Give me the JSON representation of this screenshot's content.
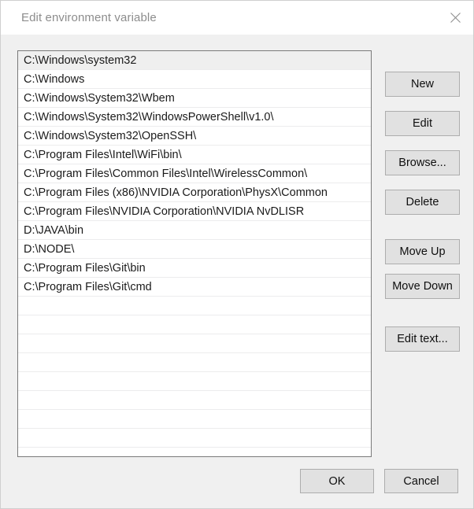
{
  "window": {
    "title": "Edit environment variable",
    "close_icon": "close-icon"
  },
  "list": {
    "selected_index": 0,
    "empty_row_count": 9,
    "items": [
      "C:\\Windows\\system32",
      "C:\\Windows",
      "C:\\Windows\\System32\\Wbem",
      "C:\\Windows\\System32\\WindowsPowerShell\\v1.0\\",
      "C:\\Windows\\System32\\OpenSSH\\",
      "C:\\Program Files\\Intel\\WiFi\\bin\\",
      "C:\\Program Files\\Common Files\\Intel\\WirelessCommon\\",
      "C:\\Program Files (x86)\\NVIDIA Corporation\\PhysX\\Common",
      "C:\\Program Files\\NVIDIA Corporation\\NVIDIA NvDLISR",
      "D:\\JAVA\\bin",
      "D:\\NODE\\",
      "C:\\Program Files\\Git\\bin",
      "C:\\Program Files\\Git\\cmd"
    ]
  },
  "side_buttons": {
    "new": "New",
    "edit": "Edit",
    "browse": "Browse...",
    "delete": "Delete",
    "move_up": "Move Up",
    "move_down": "Move Down",
    "edit_text": "Edit text..."
  },
  "footer": {
    "ok": "OK",
    "cancel": "Cancel"
  },
  "colors": {
    "body_background": "#f0f0f0",
    "titlebar_background": "#ffffff",
    "title_text": "#8d8d8d",
    "list_background": "#ffffff",
    "list_border": "#7a7a7a",
    "row_separator": "#ececed",
    "row_selected": "#efefef",
    "button_face": "#e1e1e1",
    "button_border": "#adadad",
    "text": "#1b1b1b"
  }
}
